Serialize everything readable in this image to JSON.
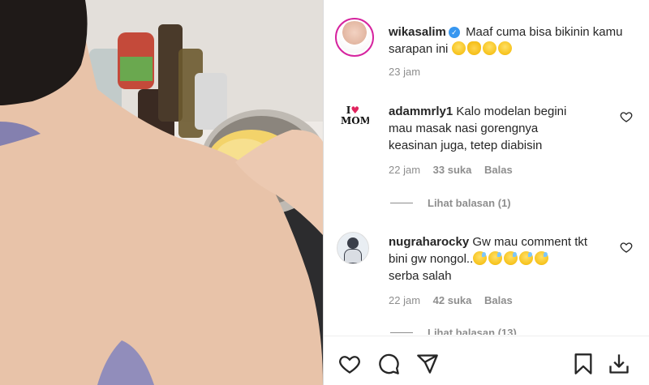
{
  "post": {
    "username": "wikasalim",
    "caption": "Maaf cuma bisa bikinin kamu sarapan ini",
    "time": "23 jam"
  },
  "comments": [
    {
      "username": "adammrly1",
      "text_line1": "Kalo modelan begini",
      "text_line2": "mau masak nasi gorengnya",
      "text_line3": "keasinan juga, tetep diabisin",
      "time": "22 jam",
      "likes": "33 suka",
      "reply": "Balas",
      "view_replies": "Lihat balasan (1)",
      "avatar_text_top": "I",
      "avatar_text_bottom": "MOM"
    },
    {
      "username": "nugraharocky",
      "text_line1": "Gw mau comment tkt",
      "text_line2": "bini gw nongol..",
      "text_line3": "serba salah",
      "time": "22 jam",
      "likes": "42 suka",
      "reply": "Balas",
      "view_replies": "Lihat balasan (13)"
    }
  ],
  "icons": {
    "like": "heart-icon",
    "comment": "comment-icon",
    "share": "share-icon",
    "save": "bookmark-icon",
    "download": "download-icon"
  },
  "colors": {
    "story_ring": "#d6249f",
    "verified": "#3897f0",
    "muted": "#8e8e8e",
    "text": "#262626"
  }
}
